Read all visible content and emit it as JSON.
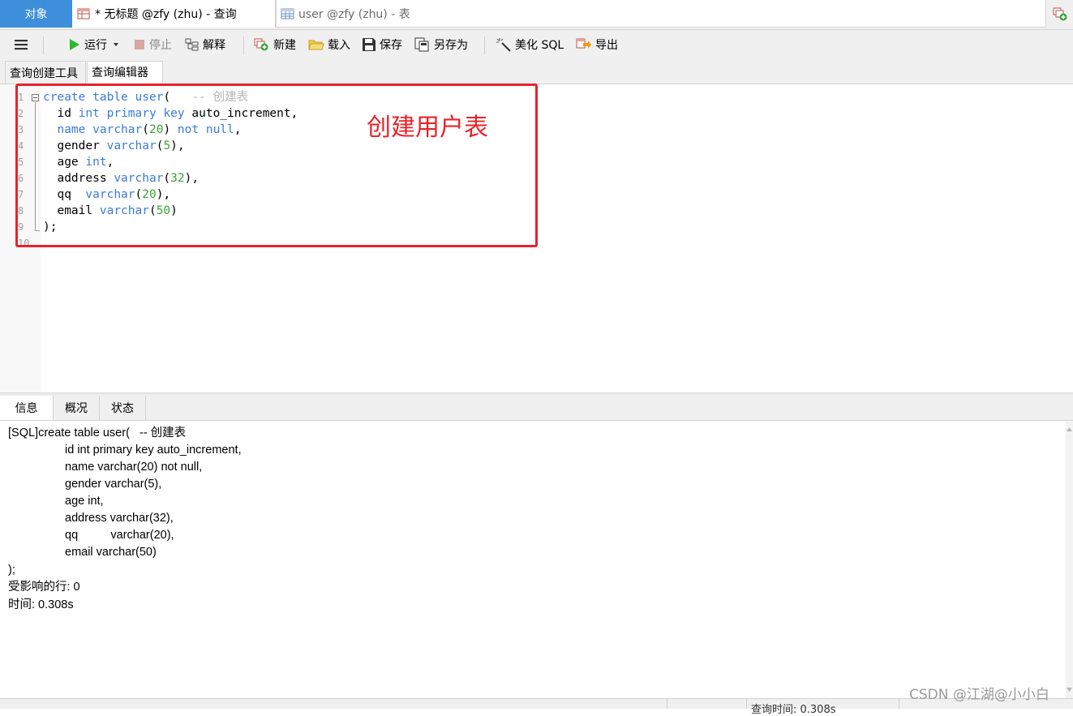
{
  "window_tabs": {
    "objects": "对象",
    "query": "* 无标题 @zfy (zhu) - 查询",
    "table": "user @zfy (zhu) - 表"
  },
  "toolbar": {
    "menu_icon": "hamburger-icon",
    "run": "运行",
    "stop": "停止",
    "explain": "解释",
    "new": "新建",
    "load": "载入",
    "save": "保存",
    "save_as": "另存为",
    "beautify": "美化 SQL",
    "export": "导出"
  },
  "sub_tabs": {
    "builder": "查询创建工具",
    "editor": "查询编辑器"
  },
  "editor": {
    "line_numbers": [
      "1",
      "2",
      "3",
      "4",
      "5",
      "6",
      "7",
      "8",
      "9",
      "10"
    ],
    "annotation": "创建用户表",
    "colors": {
      "keyword": "#3b7bd8",
      "number": "#3aa23a",
      "comment": "#b5b5b5",
      "highlight": "#e8232a"
    },
    "lines": {
      "l1": {
        "kw1": "create",
        "kw2": "table",
        "kw3": "user",
        "p1": "(",
        "cm": "-- 创建表"
      },
      "l2": {
        "t1": "id",
        "kw1": "int",
        "kw2": "primary",
        "kw3": "key",
        "t2": "auto_increment,"
      },
      "l3": {
        "kw1": "name",
        "kw2": "varchar",
        "p1": "(",
        "n1": "20",
        "p2": ")",
        "kw3": "not",
        "kw4": "null",
        "p3": ","
      },
      "l4": {
        "t1": "gender",
        "kw1": "varchar",
        "p1": "(",
        "n1": "5",
        "p2": "),"
      },
      "l5": {
        "t1": "age",
        "kw1": "int",
        "p1": ","
      },
      "l6": {
        "t1": "address",
        "kw1": "varchar",
        "p1": "(",
        "n1": "32",
        "p2": "),"
      },
      "l7": {
        "t1": "qq",
        "kw1": "varchar",
        "p1": "(",
        "n1": "20",
        "p2": "),"
      },
      "l8": {
        "t1": "email",
        "kw1": "varchar",
        "p1": "(",
        "n1": "50",
        "p2": ")"
      },
      "l9": {
        "t1": ");"
      }
    }
  },
  "bottom_tabs": {
    "info": "信息",
    "overview": "概况",
    "status": "状态"
  },
  "output": {
    "lines": [
      "[SQL]create table user(   -- 创建表",
      "id int primary key auto_increment,",
      "name varchar(20) not null,",
      "gender varchar(5),",
      "age int,",
      "address varchar(32),",
      "qq          varchar(20),",
      "email varchar(50)",
      ");",
      "受影响的行: 0",
      "时间: 0.308s"
    ]
  },
  "status_bar": {
    "query_time": "查询时间: 0.308s"
  },
  "watermark": "CSDN @江湖@小小白"
}
